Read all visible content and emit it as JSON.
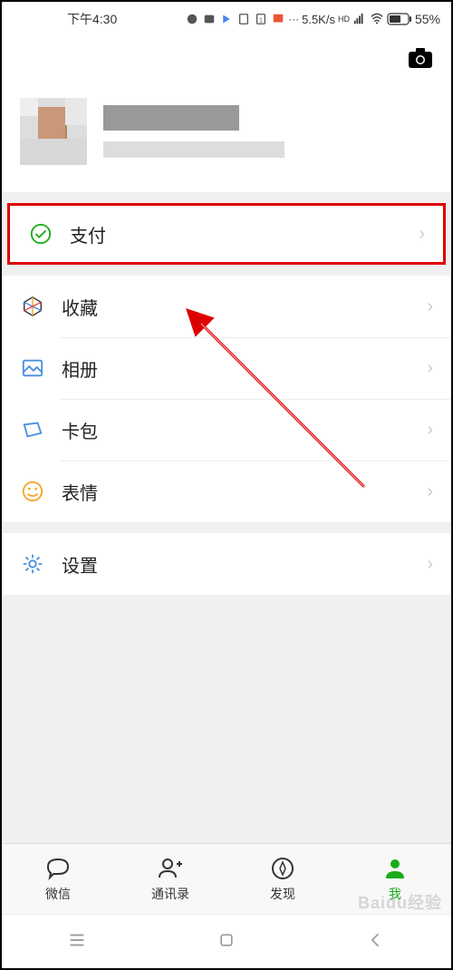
{
  "status": {
    "time": "下午4:30",
    "net_speed": "5.5K/s",
    "battery": "55%",
    "hd": "HD"
  },
  "menu": {
    "pay": "支付",
    "favorites": "收藏",
    "album": "相册",
    "cards": "卡包",
    "stickers": "表情",
    "settings": "设置"
  },
  "tabs": {
    "chat": "微信",
    "contacts": "通讯录",
    "discover": "发现",
    "me": "我"
  },
  "colors": {
    "accent": "#1aad19",
    "highlight": "#d00"
  },
  "watermark": "Baidu经验"
}
